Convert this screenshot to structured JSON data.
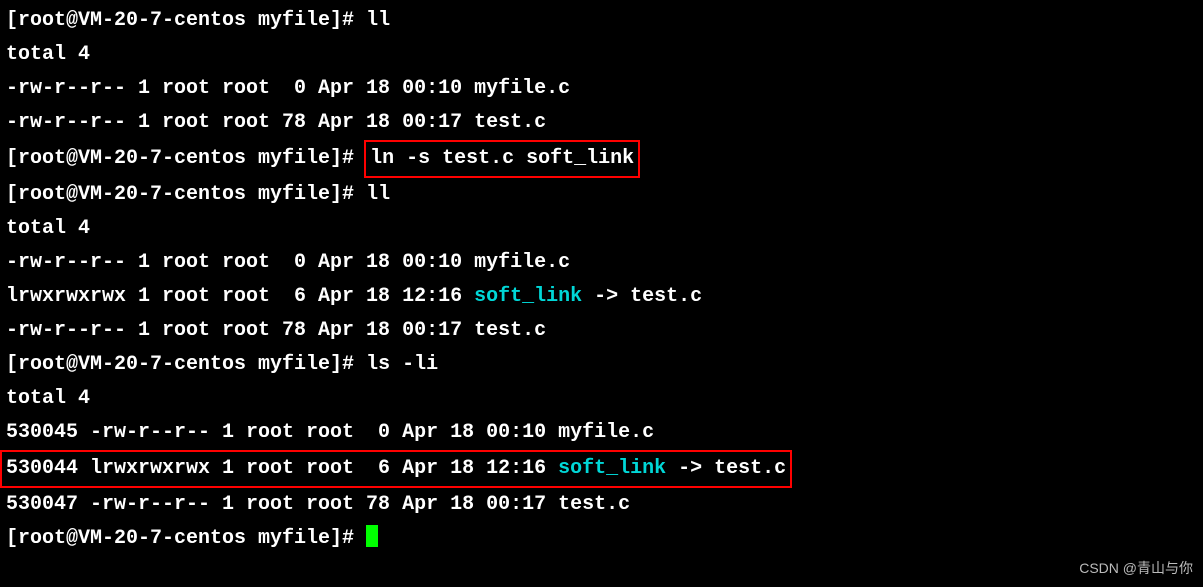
{
  "prompt": "[root@VM-20-7-centos myfile]# ",
  "commands": {
    "ll1": "ll",
    "ln": "ln -s test.c soft_link",
    "ll2": "ll",
    "lsli": "ls -li"
  },
  "listing1": {
    "total": "total 4",
    "rows": [
      "-rw-r--r-- 1 root root  0 Apr 18 00:10 myfile.c",
      "-rw-r--r-- 1 root root 78 Apr 18 00:17 test.c"
    ]
  },
  "listing2": {
    "total": "total 4",
    "row1": "-rw-r--r-- 1 root root  0 Apr 18 00:10 myfile.c",
    "row2_pre": "lrwxrwxrwx 1 root root  6 Apr 18 12:16 ",
    "row2_link": "soft_link",
    "row2_post": " -> test.c",
    "row3": "-rw-r--r-- 1 root root 78 Apr 18 00:17 test.c"
  },
  "listing3": {
    "total": "total 4",
    "row1": "530045 -rw-r--r-- 1 root root  0 Apr 18 00:10 myfile.c",
    "row2_pre": "530044 lrwxrwxrwx 1 root root  6 Apr 18 12:16 ",
    "row2_link": "soft_link",
    "row2_post": " -> test.c",
    "row3": "530047 -rw-r--r-- 1 root root 78 Apr 18 00:17 test.c"
  },
  "watermark": "CSDN @青山与你"
}
